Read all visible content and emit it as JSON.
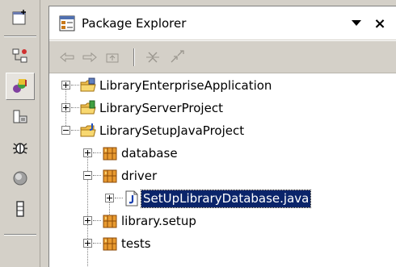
{
  "view": {
    "title": "Package Explorer",
    "menu_icon": "chevron-down-icon",
    "close_label": "×"
  },
  "toolbar": {
    "buttons": [
      "back-icon",
      "forward-icon",
      "up-icon",
      "collapse-all-icon",
      "link-with-editor-icon"
    ]
  },
  "left_toolbar": {
    "icons": [
      "open-perspective-icon",
      "hierarchy-icon",
      "java-perspective-icon",
      "resource-perspective-icon",
      "debug-icon",
      "cvs-icon",
      "server-icon"
    ]
  },
  "tree": {
    "items": [
      {
        "label": "LibraryEnterpriseApplication",
        "icon": "ear-project-icon",
        "expanded": false
      },
      {
        "label": "LibraryServerProject",
        "icon": "server-project-icon",
        "expanded": false
      },
      {
        "label": "LibrarySetupJavaProject",
        "icon": "java-project-icon",
        "expanded": true
      },
      {
        "label": "database",
        "icon": "package-icon",
        "expanded": false
      },
      {
        "label": "driver",
        "icon": "package-icon",
        "expanded": true
      },
      {
        "label": "SetUpLibraryDatabase.java",
        "icon": "java-file-icon",
        "expanded": false,
        "selected": true
      },
      {
        "label": "library.setup",
        "icon": "package-icon",
        "expanded": false
      },
      {
        "label": "tests",
        "icon": "package-icon",
        "expanded": false
      }
    ]
  },
  "colors": {
    "selection": "#0a246a",
    "chrome": "#d4d0c8",
    "folder": "#e8b040",
    "package": "#c87818"
  }
}
